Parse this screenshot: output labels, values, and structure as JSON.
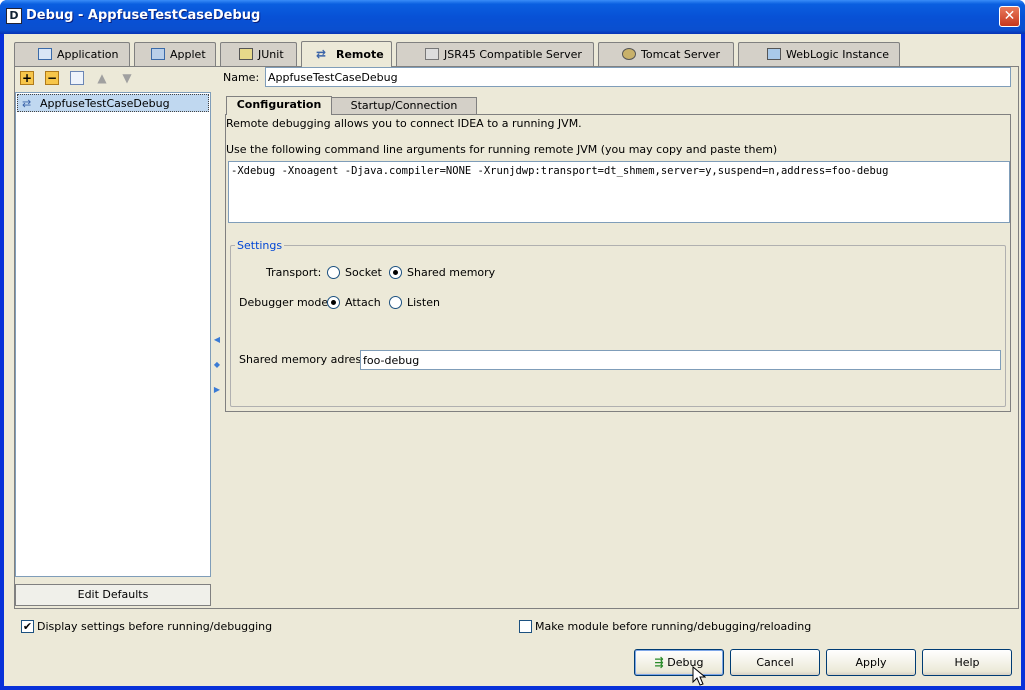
{
  "window": {
    "title": "Debug - AppfuseTestCaseDebug"
  },
  "tabs": [
    {
      "label": "Application",
      "icon": "application-icon"
    },
    {
      "label": "Applet",
      "icon": "applet-icon"
    },
    {
      "label": "JUnit",
      "icon": "junit-icon"
    },
    {
      "label": "Remote",
      "icon": "remote-icon",
      "active": true
    },
    {
      "label": "JSR45 Compatible Server",
      "icon": "jsr45-icon"
    },
    {
      "label": "Tomcat Server",
      "icon": "tomcat-icon"
    },
    {
      "label": "WebLogic Instance",
      "icon": "weblogic-icon"
    }
  ],
  "config_list": {
    "items": [
      "AppfuseTestCaseDebug"
    ],
    "edit_defaults": "Edit Defaults"
  },
  "name": {
    "label": "Name:",
    "value": "AppfuseTestCaseDebug"
  },
  "inner_tabs": [
    "Configuration",
    "Startup/Connection"
  ],
  "config": {
    "intro": "Remote debugging allows you to connect IDEA to a running JVM.",
    "args_label": "Use the following command line arguments for running remote JVM (you may copy and paste them)",
    "args": "-Xdebug -Xnoagent -Djava.compiler=NONE -Xrunjdwp:transport=dt_shmem,server=y,suspend=n,address=foo-debug",
    "settings_legend": "Settings",
    "transport_label": "Transport:",
    "transport_options": [
      "Socket",
      "Shared memory"
    ],
    "transport_selected": "Shared memory",
    "mode_label": "Debugger mode:",
    "mode_options": [
      "Attach",
      "Listen"
    ],
    "mode_selected": "Attach",
    "shm_label": "Shared memory adress:",
    "shm_value": "foo-debug"
  },
  "footer": {
    "display_settings": "Display settings before running/debugging",
    "display_settings_checked": true,
    "make_module": "Make module before running/debugging/reloading",
    "make_module_checked": false
  },
  "buttons": {
    "debug": "Debug",
    "cancel": "Cancel",
    "apply": "Apply",
    "help": "Help"
  },
  "colors": {
    "title_bar": "#0851d6",
    "selection": "#c0d8f0",
    "legend": "#0046d5"
  }
}
